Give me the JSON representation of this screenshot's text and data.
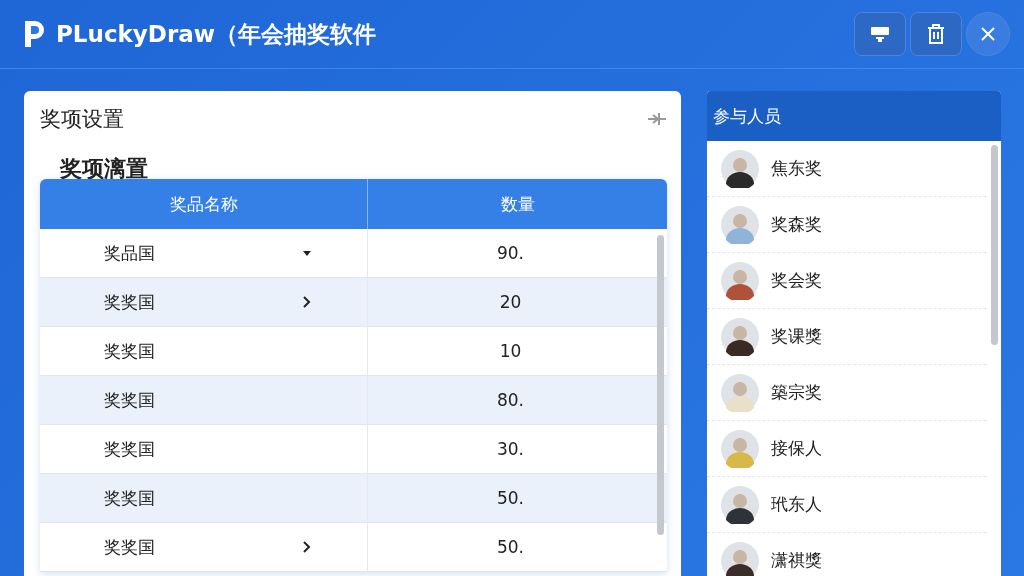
{
  "window": {
    "title": "PLuckyDraw（年会抽奖软件"
  },
  "prize_panel": {
    "title": "奖项设置",
    "subtitle": "奖项漓置",
    "table": {
      "columns": [
        "奖品名称",
        "数量"
      ],
      "rows": [
        {
          "name": "奖品国",
          "kind": "dropdown",
          "quantity": "90."
        },
        {
          "name": "奖奖国",
          "kind": "expand",
          "quantity": "20"
        },
        {
          "name": "奖奖国",
          "kind": "plain",
          "quantity": "10"
        },
        {
          "name": "奖奖国",
          "kind": "plain",
          "quantity": "80."
        },
        {
          "name": "奖奖国",
          "kind": "plain",
          "quantity": "30."
        },
        {
          "name": "奖奖国",
          "kind": "plain",
          "quantity": "50."
        },
        {
          "name": "奖奖国",
          "kind": "expand",
          "quantity": "50."
        }
      ]
    }
  },
  "participants": {
    "title": "参与人员",
    "items": [
      {
        "name": "焦东奖",
        "color": "#2b2b2b"
      },
      {
        "name": "奖森奖",
        "color": "#8fb3d9"
      },
      {
        "name": "奖会奖",
        "color": "#b0523a"
      },
      {
        "name": "奖课獎",
        "color": "#3a2a24"
      },
      {
        "name": "築宗奖",
        "color": "#e8e0c8"
      },
      {
        "name": "接保人",
        "color": "#d9b84a"
      },
      {
        "name": "玳东人",
        "color": "#2f3338"
      },
      {
        "name": "潇祺獎",
        "color": "#3b2d2a"
      }
    ]
  }
}
